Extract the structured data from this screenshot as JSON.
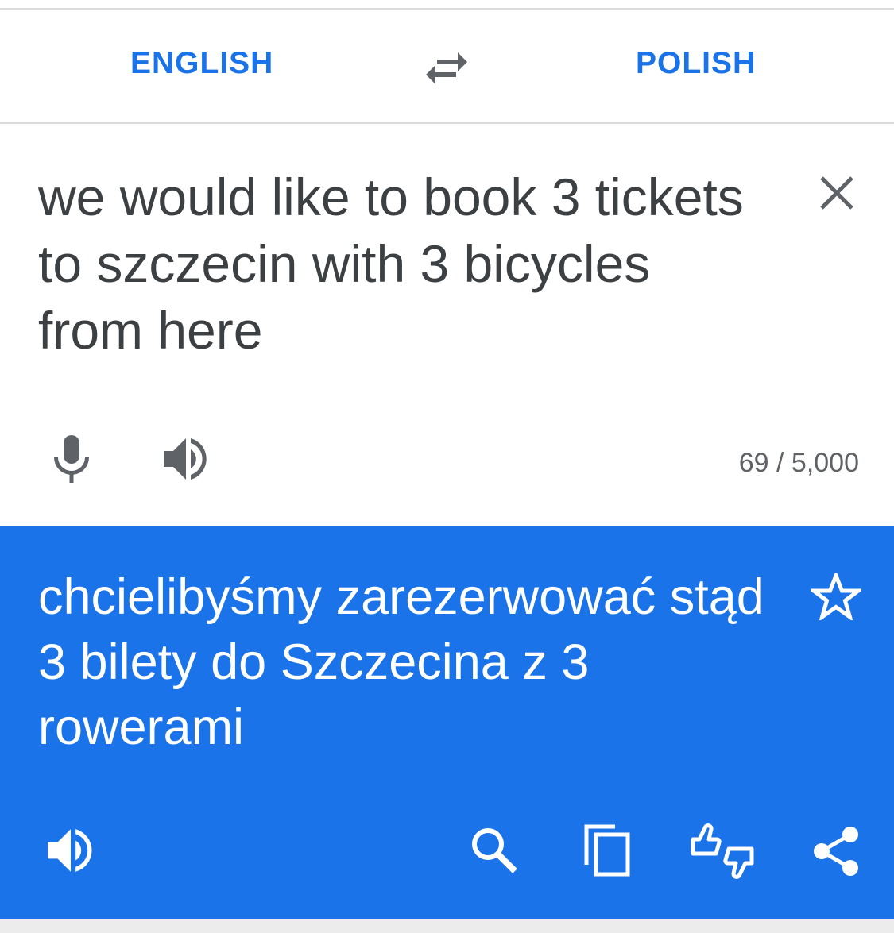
{
  "languages": {
    "source": "ENGLISH",
    "target": "POLISH"
  },
  "input": {
    "text": "we would like to book 3 tickets to szczecin with 3 bicycles from here",
    "char_count": "69 / 5,000"
  },
  "result": {
    "text": "chcielibyśmy zarezerwować stąd 3 bilety do Szczecina z 3 rowerami"
  },
  "icons": {
    "swap": "swap-horiz-icon",
    "clear": "close-icon",
    "mic": "microphone-icon",
    "speak": "volume-up-icon",
    "star": "star-outline-icon",
    "search": "search-icon",
    "copy": "copy-icon",
    "feedback": "thumbs-feedback-icon",
    "share": "share-icon"
  },
  "colors": {
    "accent": "#1a73e8",
    "text_dark": "#3c4043",
    "text_muted": "#5f6368",
    "white": "#ffffff"
  }
}
